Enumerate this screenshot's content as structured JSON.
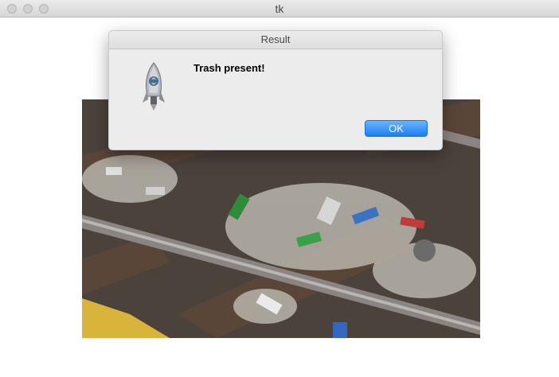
{
  "window": {
    "title": "tk"
  },
  "dialog": {
    "title": "Result",
    "message": "Trash present!",
    "ok_label": "OK",
    "icon": "python-launcher-rocket-icon"
  },
  "colors": {
    "ok_button": "#197ff5",
    "dialog_bg": "#ececec"
  }
}
